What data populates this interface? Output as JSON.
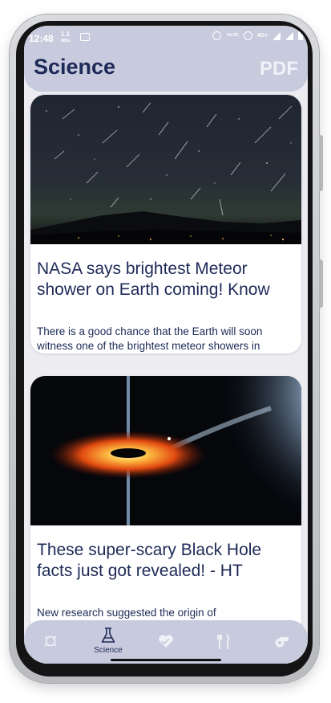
{
  "status_bar": {
    "time": "12:48",
    "speed_value": "1.1",
    "speed_unit": "MB/s",
    "network_label": "4G+",
    "volte_label": "VoLTE"
  },
  "header": {
    "title": "Science",
    "pdf_label": "PDF"
  },
  "articles": [
    {
      "title": "NASA says brightest Meteor shower on Earth coming! Know",
      "description": "There is a good chance that the Earth will soon witness one of the brightest meteor showers in",
      "image": "meteor-shower-night-sky"
    },
    {
      "title": "These super-scary Black Hole facts just got revealed! - HT",
      "description": "New research suggested the origin of",
      "image": "black-hole-illustration"
    }
  ],
  "bottom_nav": {
    "items": [
      {
        "icon": "planet-icon",
        "label": ""
      },
      {
        "icon": "flask-icon",
        "label": "Science",
        "active": true
      },
      {
        "icon": "heart-icon",
        "label": ""
      },
      {
        "icon": "fork-knife-icon",
        "label": ""
      },
      {
        "icon": "whistle-icon",
        "label": ""
      }
    ]
  },
  "colors": {
    "header_bg": "#c8cadd",
    "title_text": "#1d2a57",
    "screen_bg": "#ececf1",
    "nav_icon_inactive": "#f1f2f8"
  }
}
